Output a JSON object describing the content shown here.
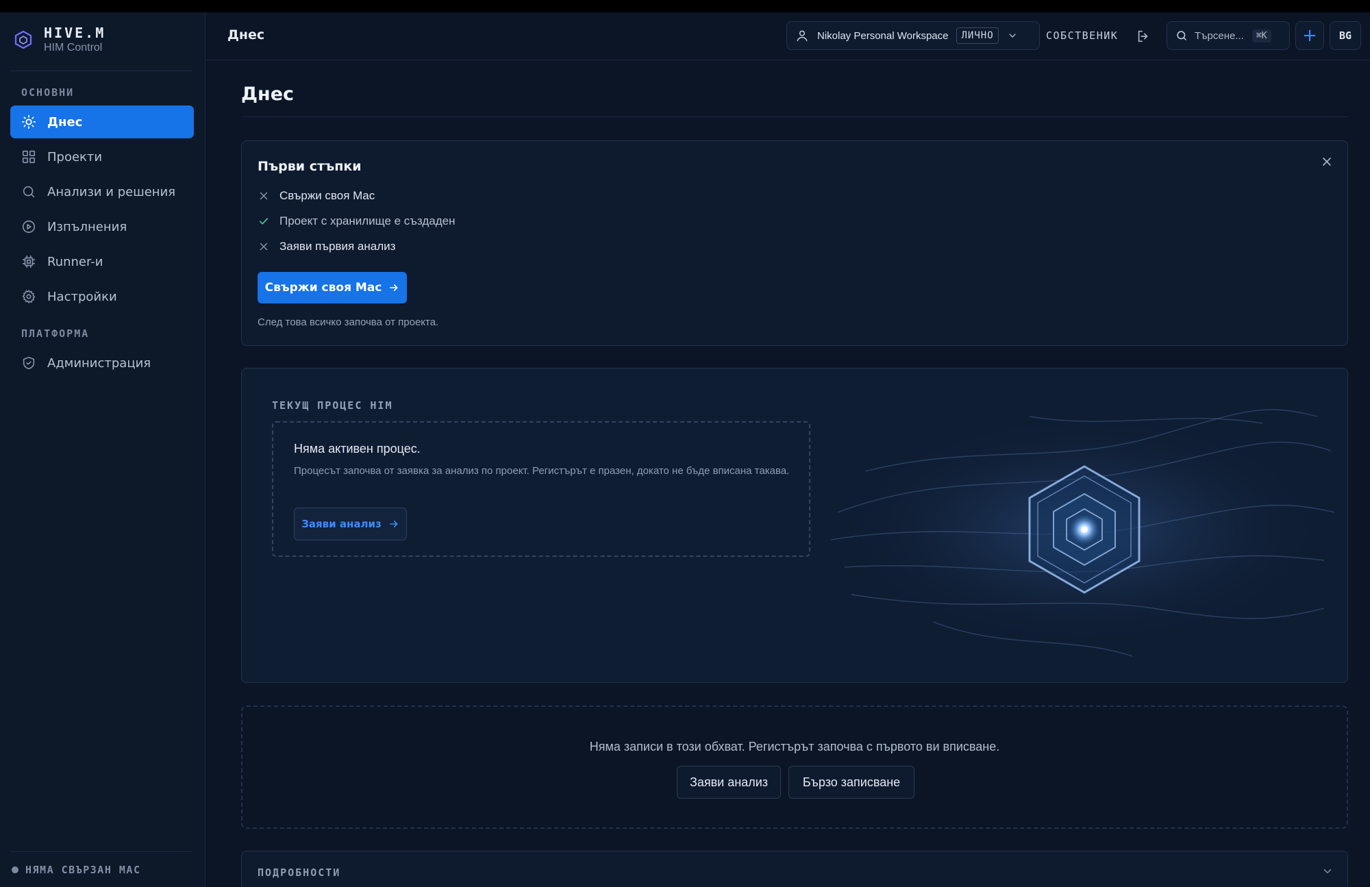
{
  "brand": {
    "title": "HIVE.M",
    "subtitle": "HIM Control"
  },
  "sidebar": {
    "section_main": "ОСНОВНИ",
    "section_platform": "ПЛАТФОРМА",
    "items": [
      {
        "label": "Днес",
        "icon": "sun-icon",
        "active": true
      },
      {
        "label": "Проекти",
        "icon": "grid-icon"
      },
      {
        "label": "Анализи и решения",
        "icon": "search-icon"
      },
      {
        "label": "Изпълнения",
        "icon": "play-circle-icon"
      },
      {
        "label": "Runner-и",
        "icon": "cpu-icon"
      },
      {
        "label": "Настройки",
        "icon": "gear-icon"
      }
    ],
    "platform_items": [
      {
        "label": "Администрация",
        "icon": "shield-icon"
      }
    ],
    "status": "НЯМА СВЪРЗАН MAC"
  },
  "header": {
    "title": "Днес",
    "workspace_name": "Nikolay Personal Workspace",
    "workspace_badge": "ЛИЧНО",
    "role": "СОБСТВЕНИК",
    "search_placeholder": "Търсене...",
    "search_shortcut": "⌘K",
    "add_label": "+",
    "language": "BG"
  },
  "page": {
    "title": "Днес"
  },
  "first_steps": {
    "title": "Първи стъпки",
    "steps": [
      {
        "label": "Свържи своя Mac",
        "done": false
      },
      {
        "label": "Проект с хранилище е създаден",
        "done": true
      },
      {
        "label": "Заяви първия анализ",
        "done": false
      }
    ],
    "button_label": "Свържи своя Mac",
    "note": "След това всичко започва от проекта."
  },
  "process": {
    "label": "ТЕКУЩ ПРОЦЕС HIM",
    "title": "Няма активен процес.",
    "description": "Процесът започва от заявка за анализ по проект. Регистърът е празен, докато не бъде вписана такава.",
    "button_label": "Заяви анализ"
  },
  "empty_state": {
    "text": "Няма записи в този обхват. Регистърът започва с първото ви вписване.",
    "button_request": "Заяви анализ",
    "button_quick": "Бързо записване"
  },
  "details": {
    "label": "ПОДРОБНОСТИ"
  },
  "colors": {
    "accent": "#1673e8",
    "background": "#0b1526",
    "success": "#3fc08a"
  }
}
